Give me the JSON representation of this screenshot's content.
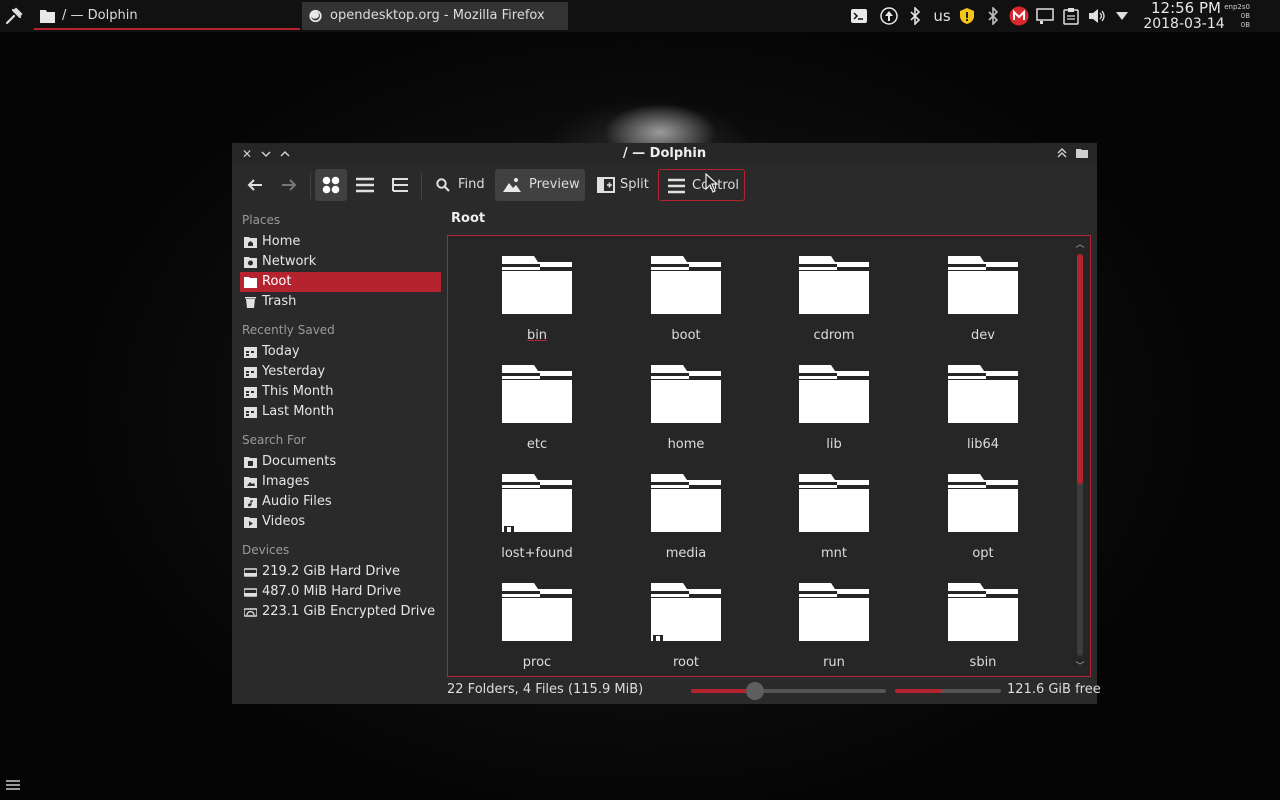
{
  "panel": {
    "tasks": [
      {
        "label": "/ — Dolphin",
        "active": true
      },
      {
        "label": "opendesktop.org - Mozilla Firefox",
        "active": false
      }
    ],
    "tray": {
      "keyboard_layout": "us",
      "icons": [
        "terminal-icon",
        "update-icon",
        "bluetooth-icon",
        "keyboard-layout",
        "security-icon",
        "bluetooth-icon-2",
        "mega-icon",
        "network-icon",
        "clipboard-icon",
        "volume-icon",
        "tray-expand-icon"
      ]
    },
    "clock": {
      "time": "12:56 PM",
      "date": "2018-03-14"
    },
    "netmon": {
      "iface": "enp2s0",
      "down": "0B",
      "up": "0B"
    }
  },
  "window": {
    "title": "/ — Dolphin",
    "toolbar": {
      "find_label": "Find",
      "preview_label": "Preview",
      "split_label": "Split",
      "control_label": "Control"
    },
    "sidebar": {
      "places_header": "Places",
      "places": [
        {
          "label": "Home",
          "icon": "home-icon"
        },
        {
          "label": "Network",
          "icon": "network-folder-icon"
        },
        {
          "label": "Root",
          "icon": "root-folder-icon",
          "selected": true
        },
        {
          "label": "Trash",
          "icon": "trash-icon"
        }
      ],
      "recent_header": "Recently Saved",
      "recent": [
        {
          "label": "Today",
          "icon": "calendar-icon"
        },
        {
          "label": "Yesterday",
          "icon": "calendar-icon"
        },
        {
          "label": "This Month",
          "icon": "calendar-icon"
        },
        {
          "label": "Last Month",
          "icon": "calendar-icon"
        }
      ],
      "search_header": "Search For",
      "search": [
        {
          "label": "Documents",
          "icon": "documents-folder-icon"
        },
        {
          "label": "Images",
          "icon": "images-folder-icon"
        },
        {
          "label": "Audio Files",
          "icon": "audio-folder-icon"
        },
        {
          "label": "Videos",
          "icon": "videos-folder-icon"
        }
      ],
      "devices_header": "Devices",
      "devices": [
        {
          "label": "219.2 GiB Hard Drive",
          "icon": "hard-drive-icon"
        },
        {
          "label": "487.0 MiB Hard Drive",
          "icon": "hard-drive-icon"
        },
        {
          "label": "223.1 GiB Encrypted Drive",
          "icon": "encrypted-drive-icon"
        }
      ]
    },
    "breadcrumb": "Root",
    "items": [
      {
        "name": "bin",
        "current": true
      },
      {
        "name": "boot"
      },
      {
        "name": "cdrom"
      },
      {
        "name": "dev"
      },
      {
        "name": "etc"
      },
      {
        "name": "home"
      },
      {
        "name": "lib"
      },
      {
        "name": "lib64"
      },
      {
        "name": "lost+found",
        "locked": true
      },
      {
        "name": "media"
      },
      {
        "name": "mnt"
      },
      {
        "name": "opt"
      },
      {
        "name": "proc"
      },
      {
        "name": "root",
        "locked": true
      },
      {
        "name": "run"
      },
      {
        "name": "sbin"
      }
    ],
    "status": {
      "summary": "22 Folders, 4 Files (115.9 MiB)",
      "zoom_fraction": 0.33,
      "space_used_fraction": 0.43,
      "free_label": "121.6 GiB free"
    },
    "colors": {
      "accent": "#b5232f",
      "background": "#2a2a2a",
      "view_background": "#262626"
    }
  }
}
